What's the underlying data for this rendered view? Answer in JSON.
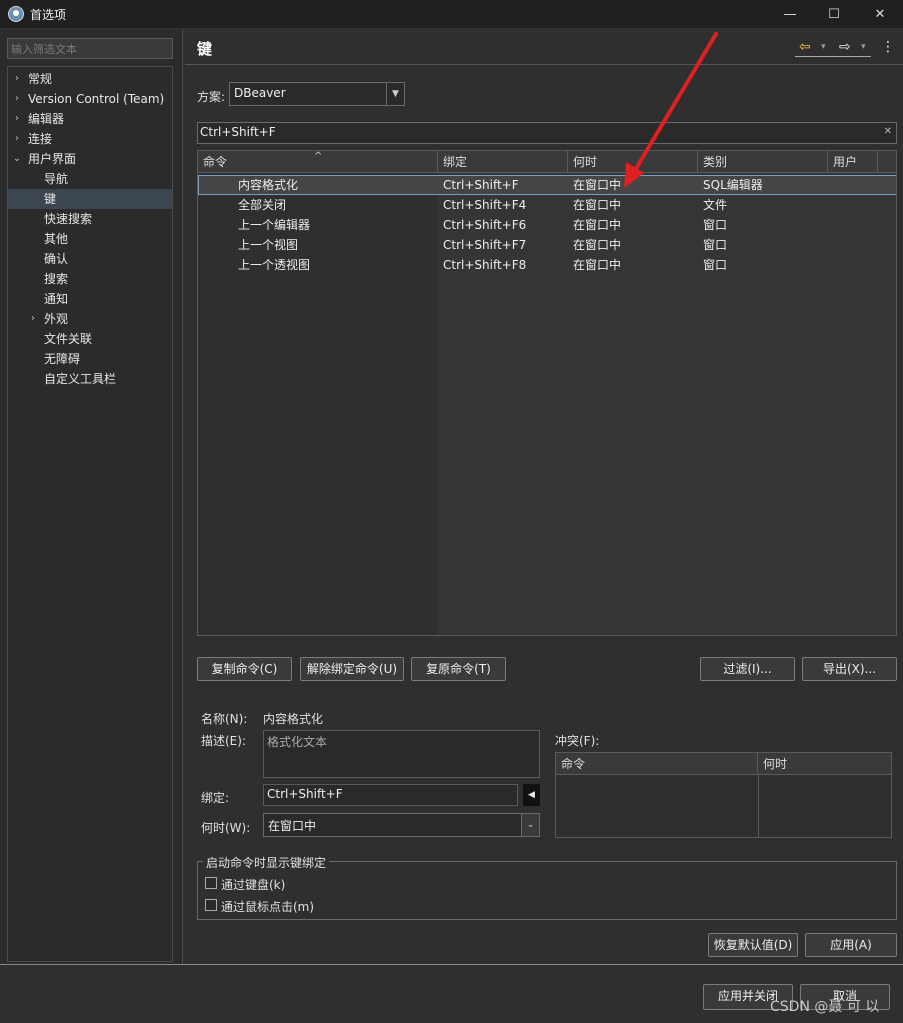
{
  "window": {
    "title": "首选项",
    "min": "—",
    "max": "☐",
    "close": "✕"
  },
  "left": {
    "filter_placeholder": "输入筛选文本",
    "tree": [
      {
        "label": "常规",
        "level": 0,
        "twisty": "›"
      },
      {
        "label": "Version Control (Team)",
        "level": 0,
        "twisty": "›"
      },
      {
        "label": "编辑器",
        "level": 0,
        "twisty": "›"
      },
      {
        "label": "连接",
        "level": 0,
        "twisty": "›"
      },
      {
        "label": "用户界面",
        "level": 0,
        "twisty": "⌄"
      },
      {
        "label": "导航",
        "level": 1,
        "twisty": ""
      },
      {
        "label": "键",
        "level": 1,
        "twisty": "",
        "selected": true
      },
      {
        "label": "快速搜索",
        "level": 1,
        "twisty": ""
      },
      {
        "label": "其他",
        "level": 1,
        "twisty": ""
      },
      {
        "label": "确认",
        "level": 1,
        "twisty": ""
      },
      {
        "label": "搜索",
        "level": 1,
        "twisty": ""
      },
      {
        "label": "通知",
        "level": 1,
        "twisty": ""
      },
      {
        "label": "外观",
        "level": 1,
        "twisty": "›"
      },
      {
        "label": "文件关联",
        "level": 1,
        "twisty": ""
      },
      {
        "label": "无障碍",
        "level": 1,
        "twisty": ""
      },
      {
        "label": "自定义工具栏",
        "level": 1,
        "twisty": ""
      }
    ]
  },
  "page": {
    "title": "键",
    "scheme_label": "方案:",
    "scheme_value": "DBeaver",
    "search_value": "Ctrl+Shift+F",
    "clear_icon": "✕",
    "nav": {
      "back": "⇦",
      "forward": "⇨",
      "menu": "⋮",
      "dropdown": "▾"
    }
  },
  "table": {
    "headers": [
      "命令",
      "绑定",
      "何时",
      "类别",
      "用户"
    ],
    "sort_indicator": "^",
    "rows": [
      {
        "command": "内容格式化",
        "binding": "Ctrl+Shift+F",
        "when": "在窗口中",
        "category": "SQL编辑器",
        "user": ""
      },
      {
        "command": "全部关闭",
        "binding": "Ctrl+Shift+F4",
        "when": "在窗口中",
        "category": "文件",
        "user": ""
      },
      {
        "command": "上一个编辑器",
        "binding": "Ctrl+Shift+F6",
        "when": "在窗口中",
        "category": "窗口",
        "user": ""
      },
      {
        "command": "上一个视图",
        "binding": "Ctrl+Shift+F7",
        "when": "在窗口中",
        "category": "窗口",
        "user": ""
      },
      {
        "command": "上一个透视图",
        "binding": "Ctrl+Shift+F8",
        "when": "在窗口中",
        "category": "窗口",
        "user": ""
      }
    ]
  },
  "actions": {
    "copy": "复制命令(C)",
    "unbind": "解除绑定命令(U)",
    "restore": "复原命令(T)",
    "filter": "过滤(I)...",
    "export": "导出(X)..."
  },
  "details": {
    "name_label": "名称(N):",
    "name_value": "内容格式化",
    "desc_label": "描述(E):",
    "desc_value": "格式化文本",
    "binding_label": "绑定:",
    "binding_value": "Ctrl+Shift+F",
    "when_label": "何时(W):",
    "when_value": "在窗口中",
    "conflict_label": "冲突(F):",
    "conflict_headers": [
      "命令",
      "何时"
    ]
  },
  "show_binding": {
    "group_label": "启动命令时显示键绑定",
    "keyboard": "通过键盘(k)",
    "mouse": "通过鼠标点击(m)"
  },
  "footer": {
    "restore_defaults": "恢复默认值(D)",
    "apply": "应用(A)",
    "apply_close": "应用并关闭",
    "cancel": "取消"
  },
  "watermark": "CSDN @聂 可 以",
  "colors": {
    "annotation_arrow": "#e02020",
    "selection_border": "#7a9ec0"
  }
}
